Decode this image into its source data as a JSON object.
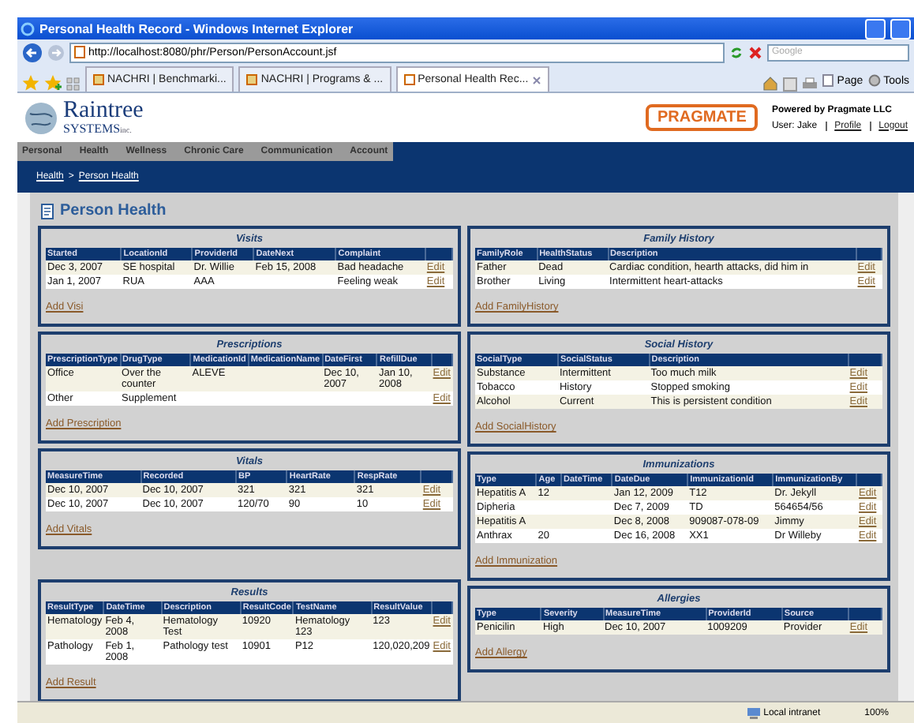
{
  "browser": {
    "title": "Personal Health Record - Windows Internet Explorer",
    "address": "http://localhost:8080/phr/Person/PersonAccount.jsf",
    "search": {
      "placeholder": "Google"
    },
    "tabs": [
      {
        "label": "NACHRI | Benchmarki...",
        "selected": false
      },
      {
        "label": "NACHRI | Programs & ...",
        "selected": false
      },
      {
        "label": "Personal Health Rec...",
        "selected": true
      }
    ],
    "commands": [
      "Page",
      "Tools"
    ]
  },
  "header": {
    "logo": {
      "name": "Raintree",
      "sub": "SYSTEMS",
      "suffix": "inc."
    },
    "partner": "PRAGMATE",
    "powered": "Powered by Pragmate LLC",
    "user": "User: Jake",
    "links": [
      "Profile",
      "Logout"
    ]
  },
  "nav": [
    "Personal",
    "Health",
    "Wellness",
    "Chronic Care",
    "Communication",
    "Account"
  ],
  "breadcrumb": {
    "items": [
      "Health",
      "Person Health"
    ],
    "separator": ">"
  },
  "page_title": "Person Health",
  "columns": [
    [
      {
        "title": "Visits",
        "columns": [
          "Started",
          "LocationId",
          "ProviderId",
          "DateNext",
          "Complaint"
        ],
        "rows": [
          {
            "cells": [
              "Dec 3, 2007",
              "SE hospital",
              "Dr. Willie",
              "Feb 15, 2008",
              "Bad headache"
            ],
            "action": "Edit"
          },
          {
            "cells": [
              "Jan 1, 2007",
              "RUA",
              "AAA",
              null,
              "Feeling weak"
            ],
            "action": "Edit"
          }
        ],
        "add": "Add Visi"
      },
      {
        "title": "Prescriptions",
        "columns": [
          "PrescriptionType",
          "DrugType",
          "MedicationId",
          "MedicationName",
          "DateFirst",
          "RefillDue"
        ],
        "rows": [
          {
            "cells": [
              "Office",
              "Over the counter",
              "ALEVE",
              null,
              "Dec 10, 2007",
              "Jan 10, 2008"
            ],
            "action": "Edit"
          },
          {
            "cells": [
              "Other",
              "Supplement",
              null,
              null,
              null,
              null
            ],
            "action": "Edit"
          }
        ],
        "add": "Add Prescription"
      },
      {
        "title": "Vitals",
        "columns": [
          "MeasureTime",
          "Recorded",
          "BP",
          "HeartRate",
          "RespRate"
        ],
        "rows": [
          {
            "cells": [
              "Dec 10, 2007",
              "Dec 10, 2007",
              "321",
              "321",
              "321"
            ],
            "action": "Edit"
          },
          {
            "cells": [
              "Dec 10, 2007",
              "Dec 10, 2007",
              "120/70",
              "90",
              "10"
            ],
            "action": "Edit"
          }
        ],
        "add": "Add Vitals"
      },
      {
        "title": "Results",
        "columns": [
          "ResultType",
          "DateTime",
          "Description",
          "ResultCode",
          "TestName",
          "ResultValue"
        ],
        "rows": [
          {
            "cells": [
              "Hematology",
              "Feb 4, 2008",
              "Hematology Test",
              "10920",
              "Hematology 123",
              "123"
            ],
            "action": "Edit"
          },
          {
            "cells": [
              "Pathology",
              "Feb 1, 2008",
              "Pathology test",
              "10901",
              "P12",
              "120,020,209"
            ],
            "action": "Edit"
          }
        ],
        "add": "Add Result"
      }
    ],
    [
      {
        "title": "Family History",
        "columns": [
          "FamilyRole",
          "HealthStatus",
          "Description"
        ],
        "rows": [
          {
            "cells": [
              "Father",
              "Dead",
              "Cardiac condition, hearth attacks, did him in"
            ],
            "action": "Edit"
          },
          {
            "cells": [
              "Brother",
              "Living",
              "Intermittent heart-attacks"
            ],
            "action": "Edit"
          }
        ],
        "add": "Add FamilyHistory"
      },
      {
        "title": "Social History",
        "columns": [
          "SocialType",
          "SocialStatus",
          "Description"
        ],
        "rows": [
          {
            "cells": [
              "Substance",
              "Intermittent",
              "Too much milk"
            ],
            "action": "Edit"
          },
          {
            "cells": [
              "Tobacco",
              "History",
              "Stopped smoking"
            ],
            "action": "Edit"
          },
          {
            "cells": [
              "Alcohol",
              "Current",
              "This is persistent condition"
            ],
            "action": "Edit"
          }
        ],
        "add": "Add SocialHistory"
      },
      {
        "title": "Immunizations",
        "columns": [
          "Type",
          "Age",
          "DateTime",
          "DateDue",
          "ImmunizationId",
          "ImmunizationBy"
        ],
        "rows": [
          {
            "cells": [
              "Hepatitis A",
              "12",
              null,
              "Jan 12, 2009",
              "T12",
              "Dr. Jekyll"
            ],
            "action": "Edit"
          },
          {
            "cells": [
              "Dipheria",
              null,
              null,
              "Dec 7, 2009",
              "TD",
              "564654/56"
            ],
            "action": "Edit"
          },
          {
            "cells": [
              "Hepatitis A",
              null,
              null,
              "Dec 8, 2008",
              "909087-078-09",
              "Jimmy"
            ],
            "action": "Edit"
          },
          {
            "cells": [
              "Anthrax",
              "20",
              null,
              "Dec 16, 2008",
              "XX1",
              "Dr Willeby"
            ],
            "action": "Edit"
          }
        ],
        "add": "Add Immunization"
      },
      {
        "title": "Allergies",
        "columns": [
          "Type",
          "Severity",
          "MeasureTime",
          "ProviderId",
          "Source"
        ],
        "rows": [
          {
            "cells": [
              "Penicilin",
              "High",
              "Dec 10, 2007",
              "1009209",
              "Provider"
            ],
            "action": "Edit"
          }
        ],
        "add": "Add Allergy"
      }
    ]
  ],
  "status_bar": {
    "zone": "Local intranet",
    "zoom": "100%"
  }
}
